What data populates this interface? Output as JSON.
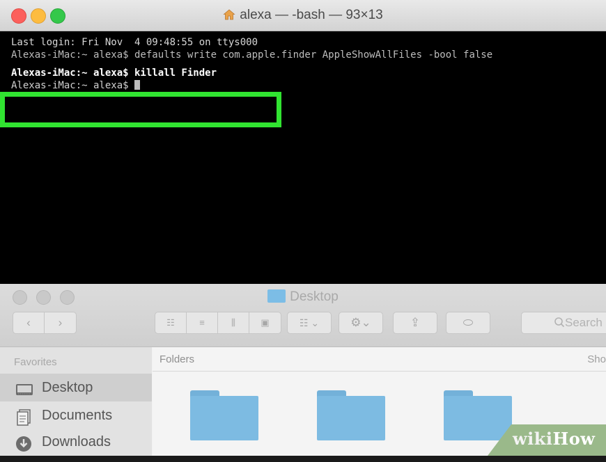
{
  "terminal": {
    "title": "alexa — -bash — 93×13",
    "title_icon": "home-icon",
    "lines": [
      "Last login: Fri Nov  4 09:48:55 on ttys000",
      "Alexas-iMac:~ alexa$ defaults write com.apple.finder AppleShowAllFiles -bool false",
      "Alexas-iMac:~ alexa$ killall Finder",
      "Alexas-iMac:~ alexa$ "
    ],
    "highlight_color": "#31e431"
  },
  "finder": {
    "title": "Desktop",
    "title_icon": "folder-icon",
    "search_placeholder": "Search",
    "sidebar": {
      "heading": "Favorites",
      "items": [
        {
          "label": "Desktop",
          "icon": "desktop-icon",
          "selected": true
        },
        {
          "label": "Documents",
          "icon": "documents-icon"
        },
        {
          "label": "Downloads",
          "icon": "downloads-icon"
        }
      ]
    },
    "main": {
      "section_label": "Folders",
      "right_label": "Sho",
      "folder_count_visible": 3
    }
  },
  "watermark": {
    "part1": "wiki",
    "part2": "How"
  }
}
